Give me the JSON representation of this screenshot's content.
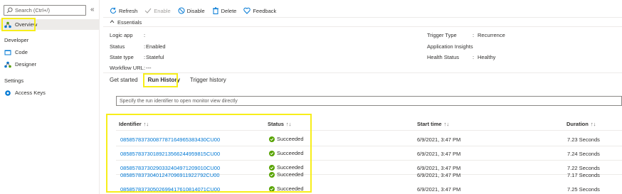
{
  "sidebar": {
    "search_placeholder": "Search (Ctrl+/)",
    "collapse_glyph": "«",
    "overview_label": "Overview",
    "developer_section": "Developer",
    "code_label": "Code",
    "designer_label": "Designer",
    "settings_section": "Settings",
    "access_keys_label": "Access Keys"
  },
  "toolbar": {
    "refresh": "Refresh",
    "enable": "Enable",
    "disable": "Disable",
    "delete": "Delete",
    "feedback": "Feedback"
  },
  "essentials": {
    "label": "Essentials",
    "left": [
      {
        "key": "Logic app",
        "value": ""
      },
      {
        "key": "Status",
        "value": "Enabled"
      },
      {
        "key": "State type",
        "value": "Stateful"
      },
      {
        "key": "Workflow URL",
        "value": "---"
      }
    ],
    "right": [
      {
        "key": "Trigger Type",
        "value": "Recurrence"
      },
      {
        "key": "Application Insights",
        "value": ""
      },
      {
        "key": "Health Status",
        "value": "Healthy"
      }
    ]
  },
  "tabs": [
    "Get started",
    "Run History",
    "Trigger history"
  ],
  "run_input_placeholder": "Specify the run identifier to open monitor view directly",
  "table": {
    "columns": [
      "Identifier",
      "Status",
      "Start time",
      "Duration"
    ],
    "rows": [
      {
        "id": "08585783730087787164965383430CU00",
        "status": "Succeeded",
        "start": "6/9/2021, 3:47 PM",
        "duration": "7.23 Seconds"
      },
      {
        "id": "08585783730189213566244959815CU00",
        "status": "Succeeded",
        "start": "6/9/2021, 3:47 PM",
        "duration": "7.24 Seconds"
      },
      {
        "id": "08585783730290332404971209010CU00",
        "status": "Succeeded",
        "start": "6/9/2021, 3:47 PM",
        "duration": "7.22 Seconds"
      },
      {
        "id": "08585783730401247096911922792CU00",
        "status": "Succeeded",
        "start": "6/9/2021, 3:47 PM",
        "duration": "7.17 Seconds"
      },
      {
        "id": "08585783730502699417610814071CU00",
        "status": "Succeeded",
        "start": "6/9/2021, 3:47 PM",
        "duration": "7.25 Seconds"
      }
    ]
  },
  "colors": {
    "highlight": "#f7ee1a",
    "link": "#0078d4",
    "success": "#57a300"
  }
}
